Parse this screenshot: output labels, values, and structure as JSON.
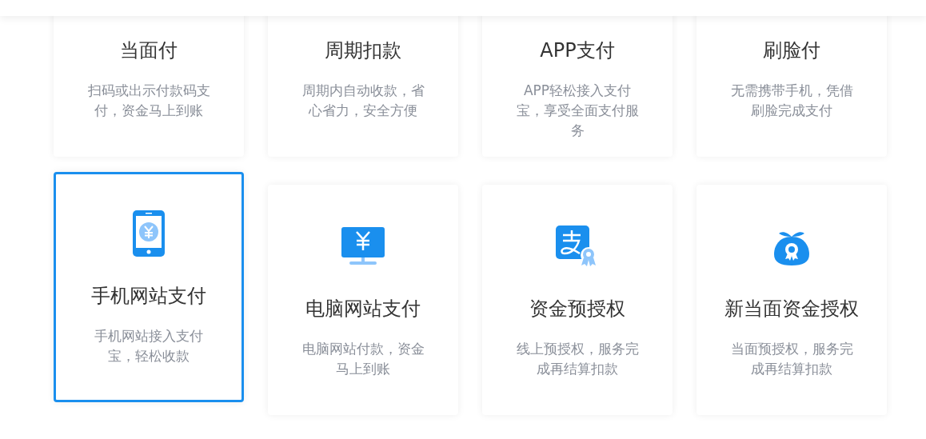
{
  "cards": [
    {
      "title": "当面付",
      "description": "扫码或出示付款码支付，资金马上到账",
      "selected": false
    },
    {
      "title": "周期扣款",
      "description": "周期内自动收款，省心省力，安全方便",
      "selected": false
    },
    {
      "title": "APP支付",
      "description": "APP轻松接入支付宝，享受全面支付服务",
      "selected": false
    },
    {
      "title": "刷脸付",
      "description": "无需携带手机，凭借刷脸完成支付",
      "selected": false
    },
    {
      "title": "手机网站支付",
      "description": "手机网站接入支付宝，轻松收款",
      "selected": true
    },
    {
      "title": "电脑网站支付",
      "description": "电脑网站付款，资金马上到账",
      "selected": false
    },
    {
      "title": "资金预授权",
      "description": "线上预授权，服务完成再结算扣款",
      "selected": false
    },
    {
      "title": "新当面资金授权",
      "description": "当面预授权，服务完成再结算扣款",
      "selected": false
    }
  ]
}
